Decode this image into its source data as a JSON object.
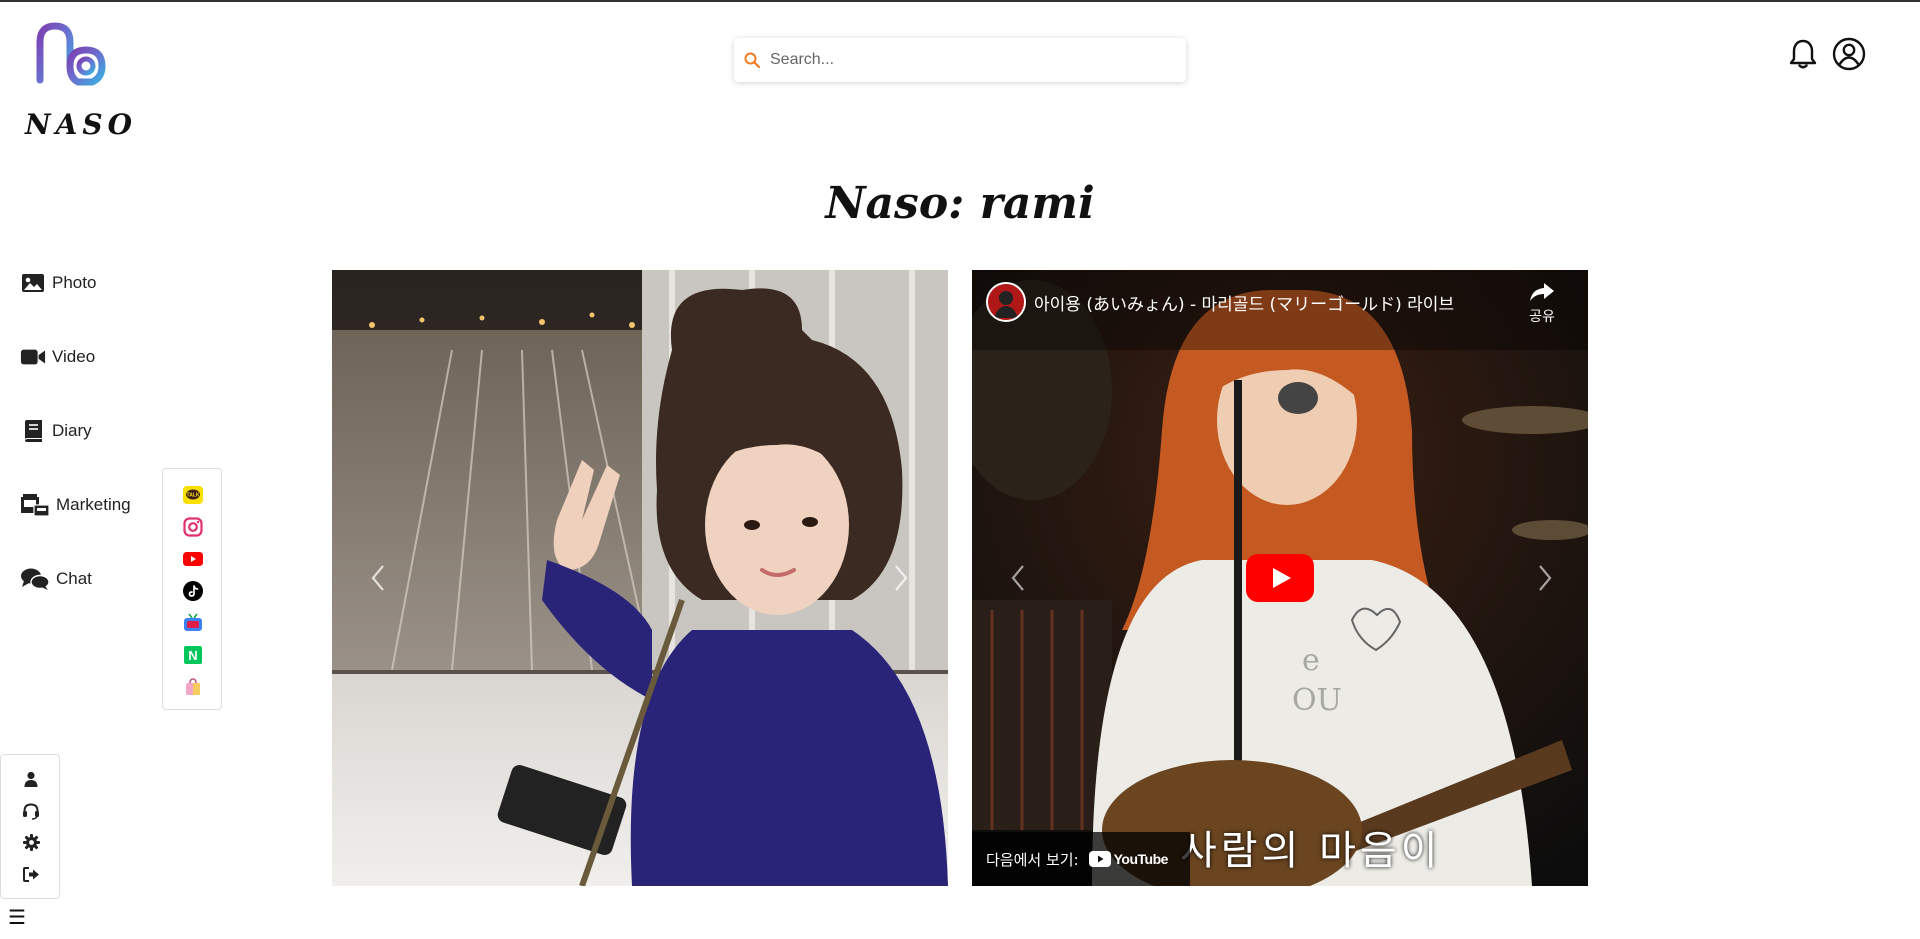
{
  "brand": {
    "logo_text": "NASO"
  },
  "search": {
    "placeholder": "Search...",
    "value": ""
  },
  "header": {
    "icons": [
      "bell-icon",
      "user-circle-icon"
    ]
  },
  "page": {
    "title": "Naso: rami"
  },
  "sidebar": {
    "items": [
      {
        "label": "Photo",
        "icon": "image-icon"
      },
      {
        "label": "Video",
        "icon": "video-camera-icon"
      },
      {
        "label": "Diary",
        "icon": "book-icon"
      },
      {
        "label": "Marketing",
        "icon": "shop-icon"
      },
      {
        "label": "Chat",
        "icon": "chat-bubbles-icon"
      }
    ]
  },
  "social_links": [
    {
      "name": "kakaotalk",
      "icon": "kakaotalk-icon",
      "label": "TALK",
      "color": "#f9e000"
    },
    {
      "name": "instagram",
      "icon": "instagram-icon",
      "color": "#e1306c"
    },
    {
      "name": "youtube",
      "icon": "youtube-icon",
      "color": "#ff0000"
    },
    {
      "name": "tiktok",
      "icon": "tiktok-icon",
      "color": "#000000"
    },
    {
      "name": "twitch",
      "icon": "tv-icon",
      "color": "#3b82f6"
    },
    {
      "name": "naver",
      "icon": "naver-icon",
      "label": "N",
      "color": "#03c75a"
    },
    {
      "name": "shop",
      "icon": "shopping-bag-icon",
      "color": "#f3a6c8"
    }
  ],
  "tools": [
    {
      "name": "profile",
      "icon": "user-icon"
    },
    {
      "name": "support",
      "icon": "headset-icon"
    },
    {
      "name": "settings",
      "icon": "gear-icon"
    },
    {
      "name": "logout",
      "icon": "sign-out-icon"
    }
  ],
  "menu": {
    "icon": "hamburger-icon",
    "glyph": "☰"
  },
  "video": {
    "title": "아이용 (あいみょん) - 마리골드 (マリーゴールド) 라이브",
    "share_label": "공유",
    "watch_on": "다음에서 보기:",
    "youtube_label": "YouTube",
    "subtitle": "사람의 마음이"
  },
  "colors": {
    "accent_search": "#f47b20",
    "youtube_red": "#ff0000",
    "logo_gradient": [
      "#8e44ad",
      "#3b9ad9"
    ]
  }
}
